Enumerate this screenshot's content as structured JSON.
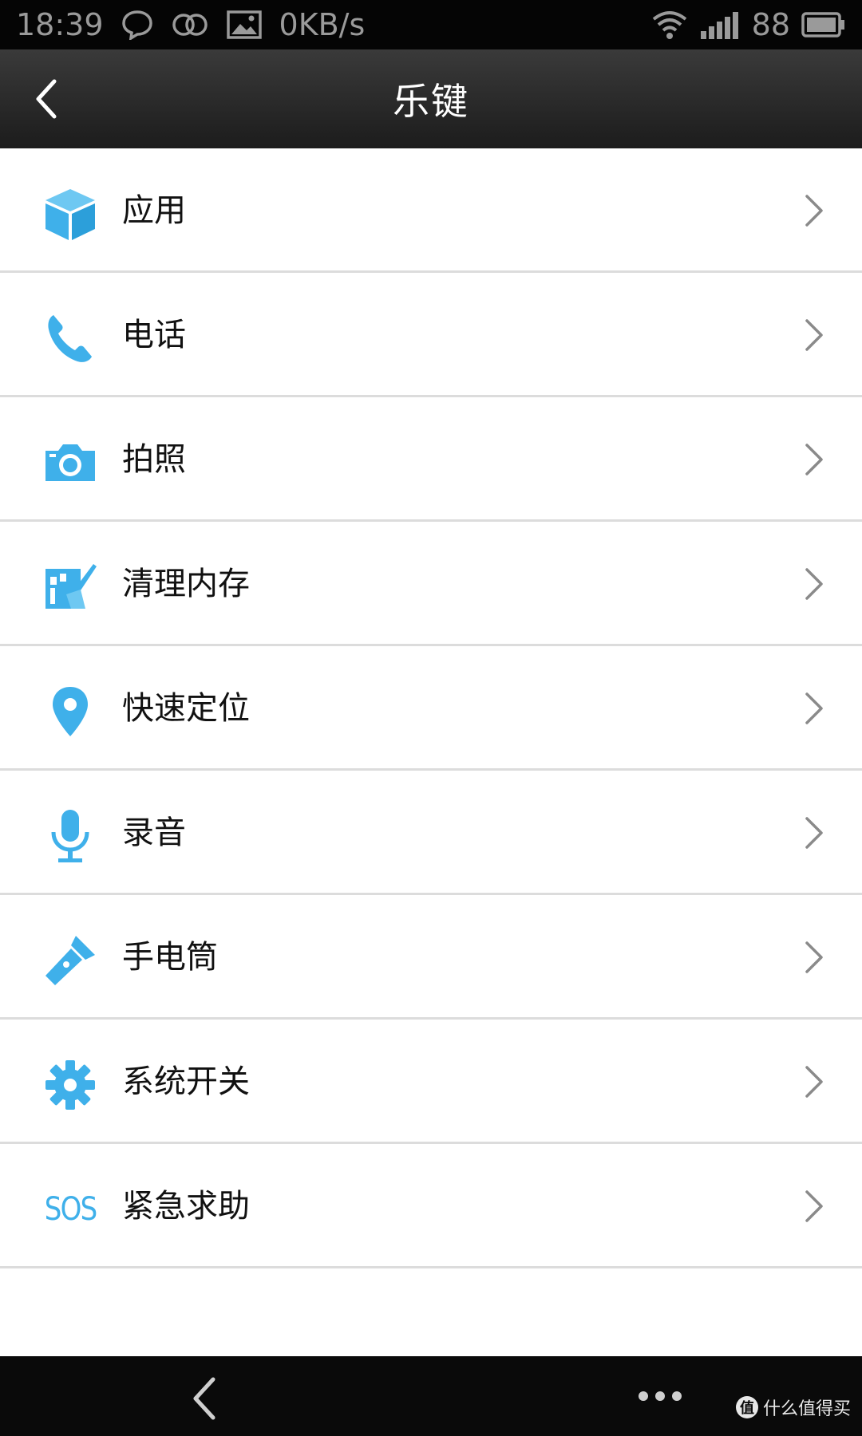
{
  "status_bar": {
    "time": "18:39",
    "net_speed": "0KB/s",
    "battery": "88",
    "icons": [
      "chat-bubble-icon",
      "infinity-icon",
      "image-icon",
      "wifi-icon",
      "signal-icon",
      "battery-icon"
    ]
  },
  "header": {
    "title": "乐键",
    "back_icon": "back-chevron-icon"
  },
  "colors": {
    "accent": "#3fb0ea",
    "header_bg": "#2a2a2a",
    "divider": "#dcdcdc"
  },
  "menu": {
    "items": [
      {
        "label": "应用",
        "icon": "box-icon"
      },
      {
        "label": "电话",
        "icon": "phone-icon"
      },
      {
        "label": "拍照",
        "icon": "camera-icon"
      },
      {
        "label": "清理内存",
        "icon": "broom-icon"
      },
      {
        "label": "快速定位",
        "icon": "location-pin-icon"
      },
      {
        "label": "录音",
        "icon": "microphone-icon"
      },
      {
        "label": "手电筒",
        "icon": "flashlight-icon"
      },
      {
        "label": "系统开关",
        "icon": "gear-icon"
      },
      {
        "label": "紧急求助",
        "icon": "sos-icon",
        "icon_text": "SOS"
      }
    ]
  },
  "bottom_nav": {
    "back_icon": "nav-back-icon",
    "more_icon": "more-dots-icon",
    "watermark_text": "什么值得买",
    "watermark_badge": "值"
  }
}
